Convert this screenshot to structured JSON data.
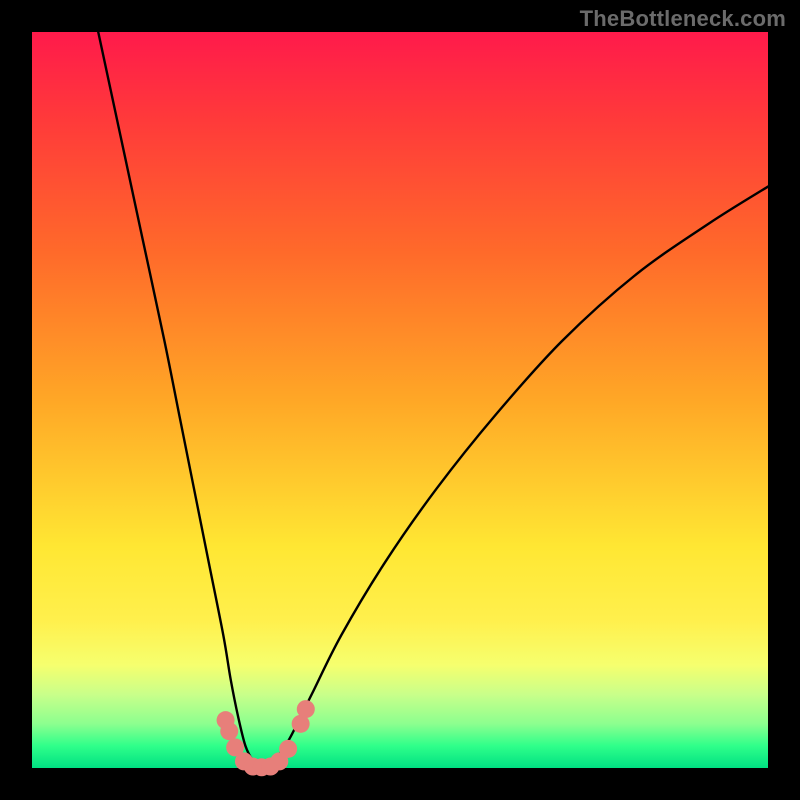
{
  "watermark": "TheBottleneck.com",
  "chart_data": {
    "type": "line",
    "title": "",
    "xlabel": "",
    "ylabel": "",
    "xlim": [
      0,
      100
    ],
    "ylim": [
      0,
      100
    ],
    "series": [
      {
        "name": "bottleneck-curve",
        "color": "#000000",
        "x": [
          9,
          12,
          15,
          18,
          20,
          22,
          24,
          26,
          27,
          28,
          29,
          30,
          31,
          32,
          33,
          35,
          38,
          42,
          48,
          55,
          63,
          72,
          82,
          92,
          100
        ],
        "values": [
          100,
          86,
          72,
          58,
          48,
          38,
          28,
          18,
          12,
          7,
          3,
          1,
          0,
          0,
          1,
          4,
          10,
          18,
          28,
          38,
          48,
          58,
          67,
          74,
          79
        ]
      }
    ],
    "markers": {
      "name": "highlight-markers",
      "color": "#e77f7a",
      "points": [
        {
          "x": 26.3,
          "y": 6.5
        },
        {
          "x": 26.8,
          "y": 5.0
        },
        {
          "x": 27.6,
          "y": 2.8
        },
        {
          "x": 28.8,
          "y": 0.9
        },
        {
          "x": 30.0,
          "y": 0.2
        },
        {
          "x": 31.2,
          "y": 0.1
        },
        {
          "x": 32.4,
          "y": 0.2
        },
        {
          "x": 33.6,
          "y": 0.9
        },
        {
          "x": 34.8,
          "y": 2.6
        },
        {
          "x": 36.5,
          "y": 6.0
        },
        {
          "x": 37.2,
          "y": 8.0
        }
      ]
    },
    "gradient_stops": [
      {
        "pos": 0.0,
        "color": "#ff1a4b"
      },
      {
        "pos": 0.12,
        "color": "#ff3a3a"
      },
      {
        "pos": 0.3,
        "color": "#ff6a2a"
      },
      {
        "pos": 0.5,
        "color": "#ffa726"
      },
      {
        "pos": 0.7,
        "color": "#ffe733"
      },
      {
        "pos": 0.8,
        "color": "#fff04d"
      },
      {
        "pos": 0.86,
        "color": "#f6ff6e"
      },
      {
        "pos": 0.9,
        "color": "#c9ff8a"
      },
      {
        "pos": 0.94,
        "color": "#8cff8f"
      },
      {
        "pos": 0.97,
        "color": "#2fff8a"
      },
      {
        "pos": 1.0,
        "color": "#00e082"
      }
    ]
  }
}
